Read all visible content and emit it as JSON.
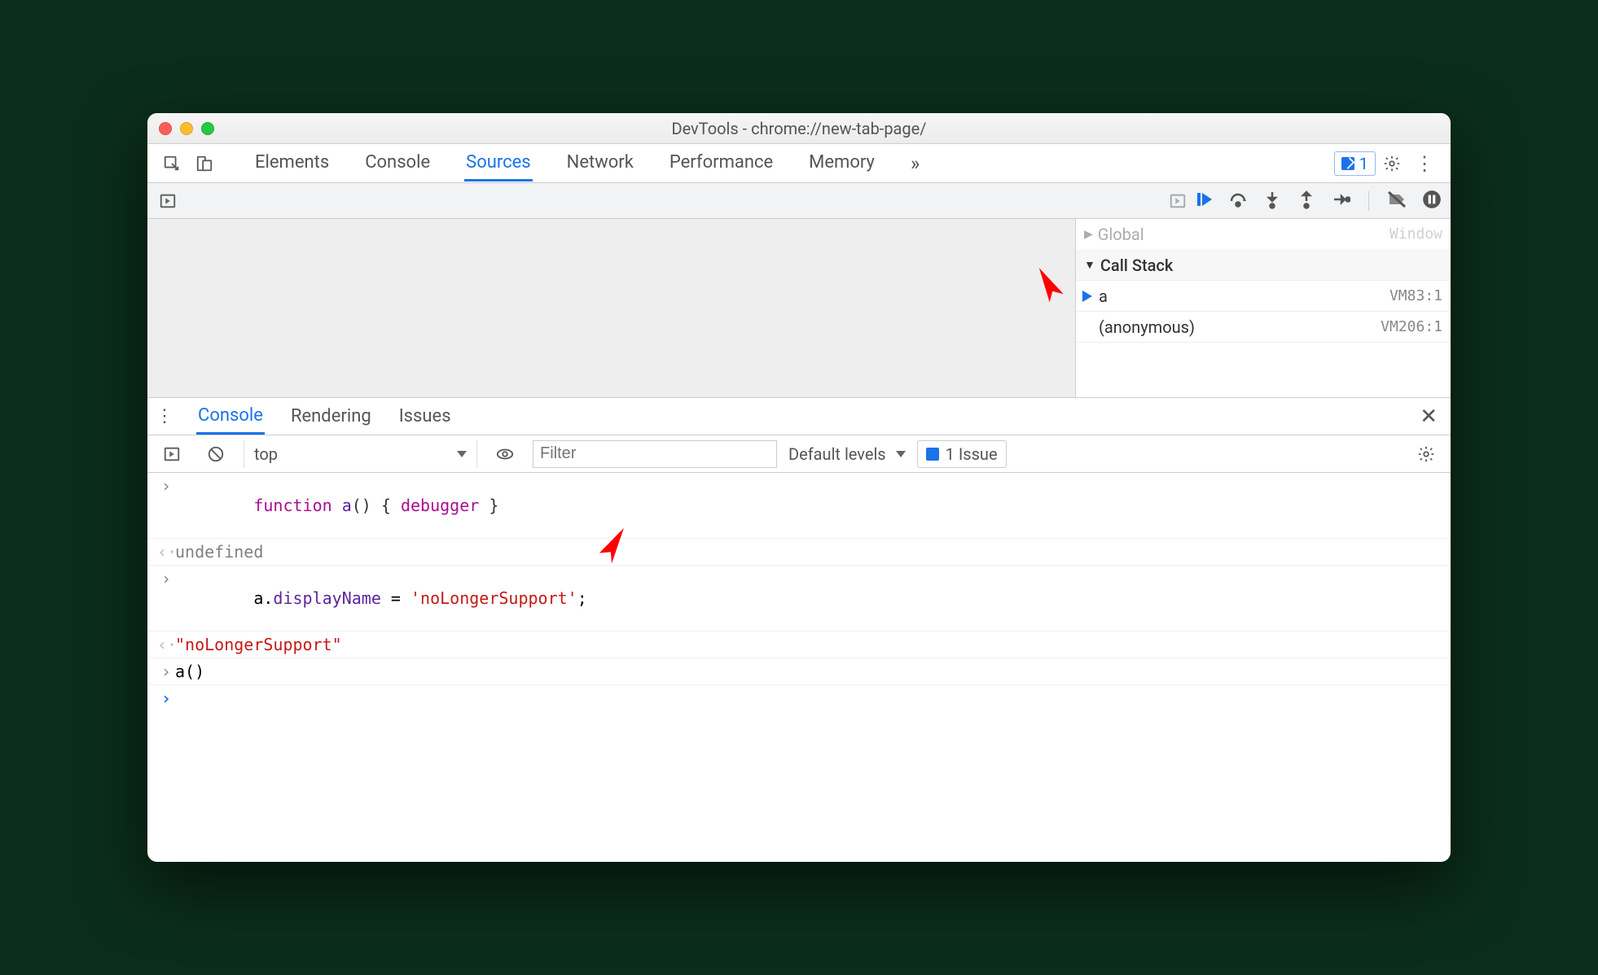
{
  "window": {
    "title": "DevTools - chrome://new-tab-page/"
  },
  "main_tabs": {
    "items": [
      "Elements",
      "Console",
      "Sources",
      "Network",
      "Performance",
      "Memory"
    ],
    "active_index": 2,
    "overflow_glyph": "»",
    "issues_count": "1"
  },
  "debug_pane": {
    "scope_fragment": {
      "label": "Global",
      "value": "Window"
    },
    "call_stack_header": "Call Stack",
    "frames": [
      {
        "name": "a",
        "location": "VM83:1",
        "current": true
      },
      {
        "name": "(anonymous)",
        "location": "VM206:1",
        "current": false
      }
    ]
  },
  "drawer_tabs": {
    "items": [
      "Console",
      "Rendering",
      "Issues"
    ],
    "active_index": 0
  },
  "console_toolbar": {
    "context": "top",
    "filter_placeholder": "Filter",
    "levels_label": "Default levels",
    "issues_label": "1 Issue"
  },
  "console_lines": [
    {
      "type": "input-code"
    },
    {
      "type": "output-undefined",
      "text": "undefined"
    },
    {
      "type": "input-assign"
    },
    {
      "type": "output-string",
      "text": "\"noLongerSupport\""
    },
    {
      "type": "input-call",
      "text": "a()"
    },
    {
      "type": "prompt",
      "text": ""
    }
  ],
  "code_tokens": {
    "line1_function": "function",
    "line1_name": "a",
    "line1_rest1": "() { ",
    "line1_debugger": "debugger",
    "line1_rest2": " }",
    "line3_obj": "a",
    "line3_dot": ".",
    "line3_prop": "displayName",
    "line3_eq": " = ",
    "line3_str": "'noLongerSupport'",
    "line3_semi": ";"
  }
}
